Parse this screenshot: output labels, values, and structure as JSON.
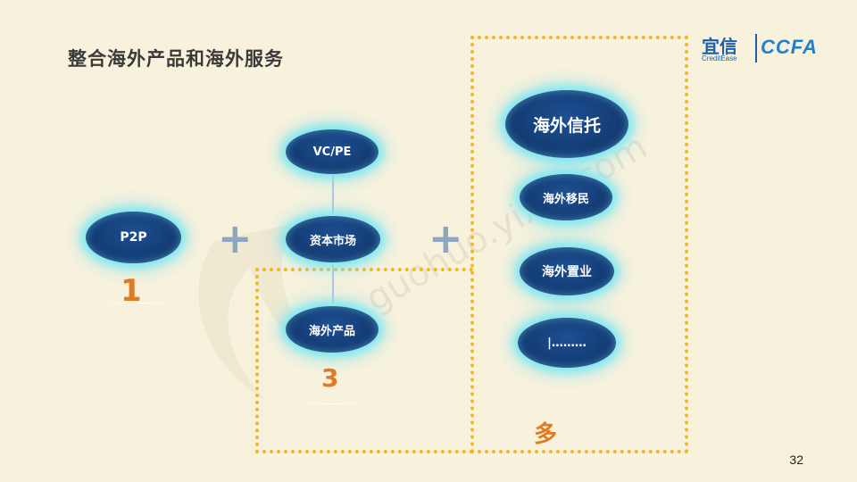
{
  "title": "整合海外产品和海外服务",
  "logo": {
    "brand_cn": "宜信",
    "brand_en": "CreditEase",
    "brand_ccfa": "CCFA"
  },
  "watermark": {
    "text_url": "guohuo.yixin.com"
  },
  "nodes": {
    "p2p": "P2P",
    "vcpe": "VC/PE",
    "capital_market": "资本市场",
    "overseas_products": "海外产品",
    "overseas_trust": "海外信托",
    "overseas_immigration": "海外移民",
    "overseas_property": "海外置业",
    "more": "|………"
  },
  "operators": {
    "plus_1": "+",
    "plus_2": "+"
  },
  "numbers": {
    "one": "1",
    "three": "3",
    "many": "多"
  },
  "page_number": "32",
  "colors": {
    "background": "#f8f2dd",
    "node_fill": "#143c74",
    "node_glow": "#7fe9f2",
    "dashed_border": "#f2b62a",
    "number_orange": "#e07a24"
  }
}
